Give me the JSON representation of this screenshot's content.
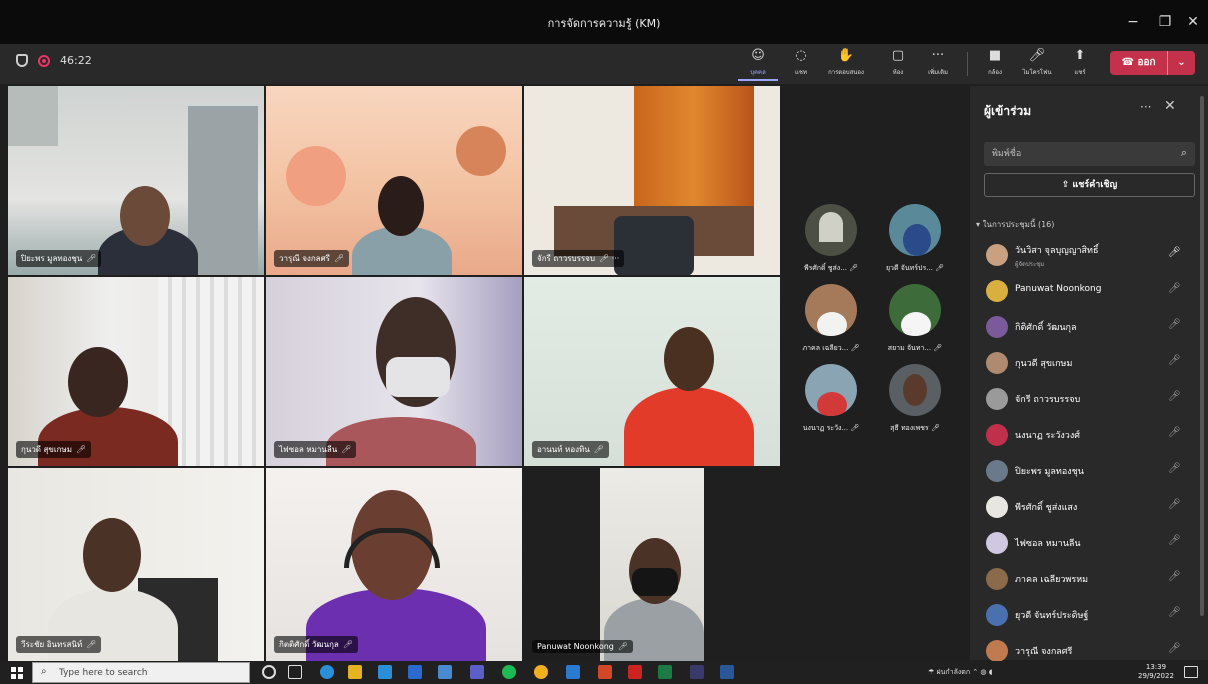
{
  "window": {
    "title": "การจัดการความรู้ (KM)"
  },
  "toolbar": {
    "timer": "46:22",
    "buttons": [
      {
        "id": "people",
        "label": "บุคคล",
        "icon": "people-icon"
      },
      {
        "id": "chat",
        "label": "แชท",
        "icon": "chat-icon"
      },
      {
        "id": "react",
        "label": "การตอบสนอง",
        "icon": "reaction-icon"
      },
      {
        "id": "rooms",
        "label": "ห้อง",
        "icon": "rooms-icon"
      },
      {
        "id": "more",
        "label": "เพิ่มเติม",
        "icon": "more-icon"
      },
      {
        "id": "camera",
        "label": "กล้อง",
        "icon": "camera-icon"
      },
      {
        "id": "mic",
        "label": "ไมโครโฟน",
        "icon": "mic-icon"
      },
      {
        "id": "share",
        "label": "แชร์",
        "icon": "share-icon"
      }
    ],
    "leave_label": "ออก"
  },
  "tiles": [
    {
      "name": "ปิยะพร มูลทองชุน"
    },
    {
      "name": "วารุณี จงกลศรี"
    },
    {
      "name": "จักรี ถาวรบรรจบ"
    },
    {
      "name": "กุนวดี สุขเกษม"
    },
    {
      "name": "ไฟซอล หมานลีน"
    },
    {
      "name": "อานนท์ หองทิน"
    },
    {
      "name": "วีระชัย อินทรสนิท์"
    },
    {
      "name": "กิตติศักดิ์ วัฒนกุล"
    },
    {
      "name": "Panuwat Noonkong"
    }
  ],
  "gallery": [
    {
      "name": "พีรศักดิ์ ชูส่ง..."
    },
    {
      "name": "ยุวดี จันทร์ปร..."
    },
    {
      "name": "ภาคล เฉลียว..."
    },
    {
      "name": "สยาม จันทา..."
    },
    {
      "name": "นงนาฏ ระวัง..."
    },
    {
      "name": "สุธี ทองเพชร"
    }
  ],
  "panel": {
    "title": "ผู้เข้าร่วม",
    "search_placeholder": "พิมพ์ชื่อ",
    "invite_label": "แชร์คำเชิญ",
    "section_label": "ในการประชุมนี้ (16)",
    "participants": [
      {
        "name": "วันวิสา จุลบุญญาสิทธิ์",
        "role": "ผู้จัดประชุม"
      },
      {
        "name": "Panuwat Noonkong"
      },
      {
        "name": "กิติศักดิ์ วัฒนกุล"
      },
      {
        "name": "กุนวดี สุขเกษม"
      },
      {
        "name": "จักรี ถาวรบรรจบ"
      },
      {
        "name": "นงนาฏ ระวังวงศ์"
      },
      {
        "name": "ปิยะพร มูลทองชุน"
      },
      {
        "name": "พีรศักดิ์ ชูส่งแสง"
      },
      {
        "name": "ไฟซอล หมานลีน"
      },
      {
        "name": "ภาคล เฉลียวพรหม"
      },
      {
        "name": "ยุวดี จันทร์ประดิษฐ์"
      },
      {
        "name": "วารุณี จงกลศรี"
      }
    ]
  },
  "taskbar": {
    "search_placeholder": "Type here to search",
    "tray_text": "ฝนกำลังตก",
    "time": "13:39",
    "date": "29/9/2022"
  }
}
